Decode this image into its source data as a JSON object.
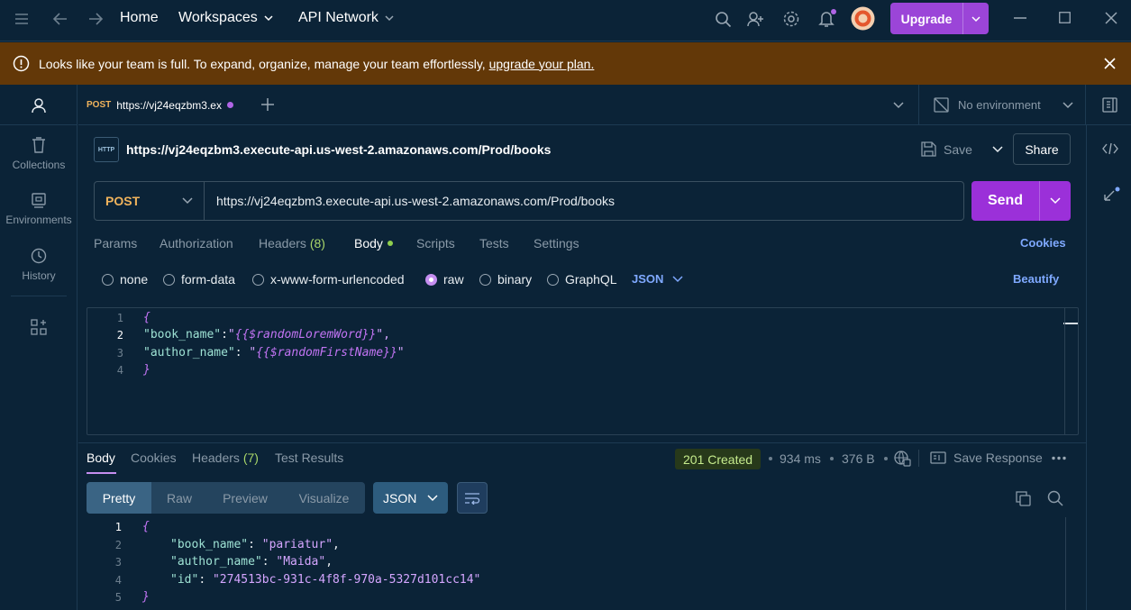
{
  "nav": {
    "home": "Home",
    "workspaces": "Workspaces",
    "api_network": "API Network",
    "upgrade": "Upgrade"
  },
  "banner": {
    "text": "Looks like your team is full. To expand, organize, manage your team effortlessly,",
    "link": "upgrade your plan."
  },
  "sidebar": {
    "items": [
      {
        "label": "Collections"
      },
      {
        "label": "Environments"
      },
      {
        "label": "History"
      }
    ]
  },
  "tab": {
    "method": "POST",
    "title": "https://vj24eqzbm3.ex"
  },
  "environment": {
    "label": "No environment"
  },
  "request": {
    "icon_text": "HTTP",
    "name": "https://vj24eqzbm3.execute-api.us-west-2.amazonaws.com/Prod/books",
    "save_label": "Save",
    "share_label": "Share",
    "method": "POST",
    "url": "https://vj24eqzbm3.execute-api.us-west-2.amazonaws.com/Prod/books",
    "send_label": "Send",
    "tabs": {
      "params": "Params",
      "authorization": "Authorization",
      "headers": "Headers",
      "headers_count": "(8)",
      "body": "Body",
      "scripts": "Scripts",
      "tests": "Tests",
      "settings": "Settings"
    },
    "cookies": "Cookies",
    "body_types": {
      "none": "none",
      "form_data": "form-data",
      "urlencoded": "x-www-form-urlencoded",
      "raw": "raw",
      "binary": "binary",
      "graphql": "GraphQL"
    },
    "format": "JSON",
    "beautify": "Beautify",
    "body_lines": {
      "l1": "{",
      "l2_key": "\"book_name\"",
      "l2_colon": ":",
      "l2_q1": "\"",
      "l2_var": "{{$randomLoremWord}}",
      "l2_q2": "\",",
      "l3_key": "\"author_name\"",
      "l3_colon": ": ",
      "l3_q1": "\"",
      "l3_var": "{{$randomFirstName}}",
      "l3_q2": "\"",
      "l4": "}"
    },
    "line_numbers": [
      "1",
      "2",
      "3",
      "4"
    ]
  },
  "response": {
    "tabs": {
      "body": "Body",
      "cookies": "Cookies",
      "headers": "Headers",
      "headers_count": "(7)",
      "test_results": "Test Results"
    },
    "status": "201 Created",
    "time": "934 ms",
    "size": "376 B",
    "save_response": "Save Response",
    "view_tabs": {
      "pretty": "Pretty",
      "raw": "Raw",
      "preview": "Preview",
      "visualize": "Visualize"
    },
    "format": "JSON",
    "lines": {
      "l1": "{",
      "l2_key": "\"book_name\"",
      "l2_val": "\"pariatur\"",
      "l3_key": "\"author_name\"",
      "l3_val": "\"Maida\"",
      "l4_key": "\"id\"",
      "l4_val": "\"274513bc-931c-4f8f-970a-5327d101cc14\"",
      "l5": "}"
    },
    "line_numbers": [
      "1",
      "2",
      "3",
      "4",
      "5"
    ]
  },
  "colors": {
    "accent": "#9b30d9",
    "method_post": "#f0b35c",
    "status_ok": "#c6ec8d",
    "banner": "#633808",
    "background": "#0b2337"
  }
}
